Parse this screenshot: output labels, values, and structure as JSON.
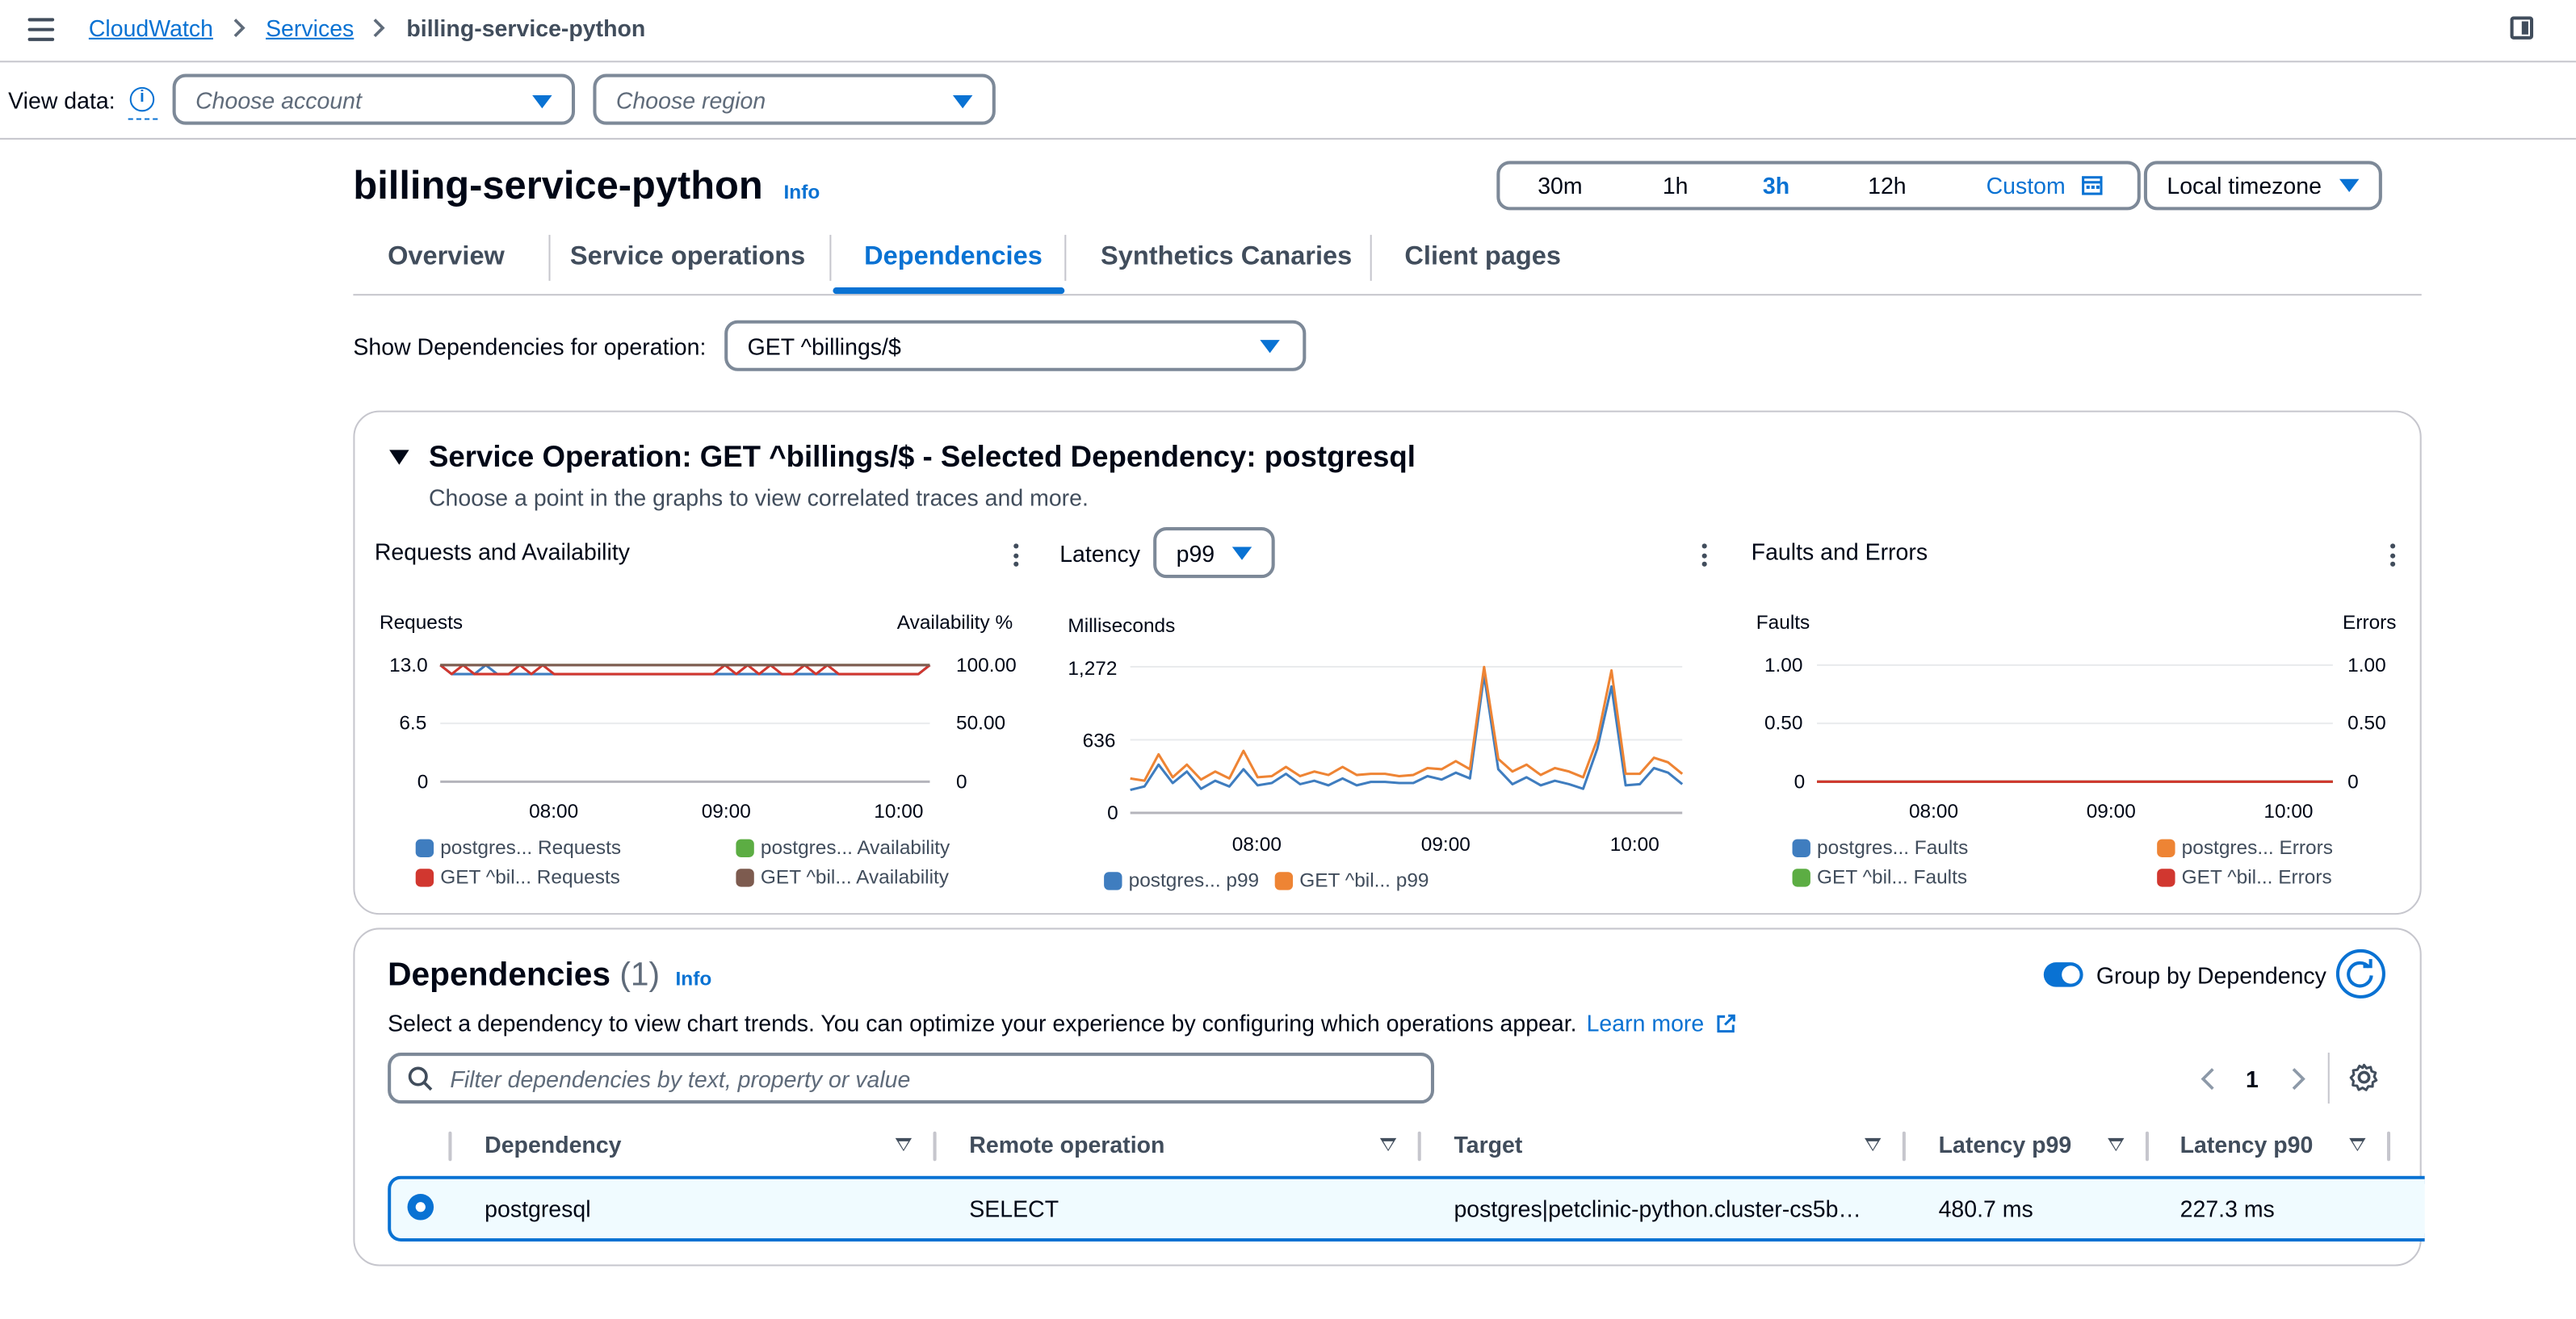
{
  "breadcrumbs": {
    "root": "CloudWatch",
    "services": "Services",
    "current": "billing-service-python"
  },
  "view_data": {
    "label": "View data:",
    "account_placeholder": "Choose account",
    "region_placeholder": "Choose region"
  },
  "header": {
    "title": "billing-service-python",
    "info": "Info"
  },
  "time_range": {
    "options": [
      "30m",
      "1h",
      "3h",
      "12h",
      "Custom"
    ],
    "selected": "3h",
    "timezone": "Local timezone"
  },
  "tabs": [
    "Overview",
    "Service operations",
    "Dependencies",
    "Synthetics Canaries",
    "Client pages"
  ],
  "active_tab": "Dependencies",
  "operation_filter": {
    "label": "Show Dependencies for operation:",
    "value": "GET ^billings/$"
  },
  "service_operation": {
    "title": "Service Operation: GET ^billings/$ - Selected Dependency: postgresql",
    "description": "Choose a point in the graphs to view correlated traces and more.",
    "requests_chart_title": "Requests and Availability",
    "latency_chart_title": "Latency",
    "latency_stat": "p99",
    "faults_chart_title": "Faults and Errors"
  },
  "colors": {
    "blue": "#3f7dbf",
    "orange": "#ee8434",
    "green": "#5cad43",
    "red": "#d1372f",
    "brown": "#7d5b4f",
    "accent": "#0972d3"
  },
  "chart_data": [
    {
      "type": "line",
      "title": "Requests and Availability",
      "ylabel": "Requests",
      "y2label": "Availability %",
      "y_ticks": [
        "13.0",
        "6.5",
        "0"
      ],
      "y2_ticks": [
        "100.00",
        "50.00",
        "0"
      ],
      "ylim": [
        0,
        13
      ],
      "y2lim": [
        0,
        100
      ],
      "x_ticks": [
        "08:00",
        "09:00",
        "10:00"
      ],
      "series": [
        {
          "name": "postgres... Requests",
          "color": "#3f7dbf",
          "axis": "left",
          "values": [
            13,
            12,
            12,
            12,
            13,
            12,
            12,
            12,
            12,
            12,
            12,
            12,
            12,
            12,
            12,
            12,
            12,
            12,
            12,
            12,
            12,
            12,
            12,
            12,
            12,
            12,
            12,
            12,
            12,
            12,
            12,
            12,
            12,
            12,
            12,
            12,
            12,
            12,
            12,
            12,
            12,
            12,
            12,
            13
          ]
        },
        {
          "name": "postgres... Availability",
          "color": "#5cad43",
          "axis": "right",
          "values": [
            100,
            100,
            100,
            100,
            100,
            100,
            100,
            100,
            100,
            100,
            100,
            100,
            100,
            100,
            100,
            100,
            100,
            100,
            100,
            100,
            100,
            100,
            100,
            100,
            100,
            100,
            100,
            100,
            100,
            100,
            100,
            100,
            100,
            100,
            100,
            100,
            100,
            100,
            100,
            100,
            100,
            100,
            100,
            100
          ]
        },
        {
          "name": "GET ^bil... Requests",
          "color": "#d1372f",
          "axis": "left",
          "values": [
            13,
            12,
            13,
            12,
            12,
            12,
            12,
            13,
            12,
            13,
            12,
            12,
            12,
            12,
            12,
            12,
            12,
            12,
            12,
            12,
            12,
            12,
            12,
            12,
            12,
            13,
            12,
            13,
            12,
            13,
            12,
            12,
            13,
            12,
            13,
            12,
            12,
            12,
            12,
            12,
            12,
            12,
            12,
            13
          ]
        },
        {
          "name": "GET ^bil... Availability",
          "color": "#7d5b4f",
          "axis": "right",
          "values": [
            100,
            100,
            100,
            100,
            100,
            100,
            100,
            100,
            100,
            100,
            100,
            100,
            100,
            100,
            100,
            100,
            100,
            100,
            100,
            100,
            100,
            100,
            100,
            100,
            100,
            100,
            100,
            100,
            100,
            100,
            100,
            100,
            100,
            100,
            100,
            100,
            100,
            100,
            100,
            100,
            100,
            100,
            100,
            100
          ]
        }
      ]
    },
    {
      "type": "line",
      "title": "Latency",
      "ylabel": "Milliseconds",
      "y_ticks": [
        "1,272",
        "636",
        "0"
      ],
      "ylim": [
        0,
        1272
      ],
      "x_ticks": [
        "08:00",
        "09:00",
        "10:00"
      ],
      "series": [
        {
          "name": "postgres... p99",
          "color": "#3f7dbf",
          "values": [
            200,
            230,
            420,
            260,
            360,
            210,
            280,
            230,
            380,
            240,
            260,
            340,
            250,
            280,
            240,
            300,
            240,
            270,
            270,
            260,
            260,
            320,
            290,
            350,
            300,
            1200,
            380,
            250,
            310,
            240,
            280,
            250,
            210,
            560,
            1100,
            240,
            250,
            390,
            350,
            250
          ]
        },
        {
          "name": "GET ^bil... p99",
          "color": "#ee8434",
          "values": [
            300,
            280,
            510,
            310,
            420,
            290,
            360,
            300,
            540,
            310,
            320,
            400,
            320,
            360,
            330,
            400,
            330,
            340,
            340,
            320,
            330,
            390,
            380,
            450,
            380,
            1270,
            470,
            360,
            420,
            330,
            390,
            360,
            310,
            640,
            1240,
            340,
            340,
            480,
            440,
            340
          ]
        }
      ]
    },
    {
      "type": "line",
      "title": "Faults and Errors",
      "ylabel": "Faults",
      "y2label": "Errors",
      "y_ticks": [
        "1.00",
        "0.50",
        "0"
      ],
      "y2_ticks": [
        "1.00",
        "0.50",
        "0"
      ],
      "ylim": [
        0,
        1
      ],
      "y2lim": [
        0,
        1
      ],
      "x_ticks": [
        "08:00",
        "09:00",
        "10:00"
      ],
      "series": [
        {
          "name": "postgres... Faults",
          "color": "#3f7dbf",
          "values": [
            0,
            0,
            0,
            0,
            0,
            0,
            0,
            0,
            0,
            0,
            0,
            0,
            0,
            0,
            0,
            0,
            0,
            0,
            0,
            0,
            0,
            0,
            0,
            0,
            0,
            0,
            0,
            0,
            0,
            0
          ]
        },
        {
          "name": "postgres... Errors",
          "color": "#ee8434",
          "values": [
            0,
            0,
            0,
            0,
            0,
            0,
            0,
            0,
            0,
            0,
            0,
            0,
            0,
            0,
            0,
            0,
            0,
            0,
            0,
            0,
            0,
            0,
            0,
            0,
            0,
            0,
            0,
            0,
            0,
            0
          ]
        },
        {
          "name": "GET ^bil... Faults",
          "color": "#5cad43",
          "values": [
            0,
            0,
            0,
            0,
            0,
            0,
            0,
            0,
            0,
            0,
            0,
            0,
            0,
            0,
            0,
            0,
            0,
            0,
            0,
            0,
            0,
            0,
            0,
            0,
            0,
            0,
            0,
            0,
            0,
            0
          ]
        },
        {
          "name": "GET ^bil... Errors",
          "color": "#d1372f",
          "values": [
            0,
            0,
            0,
            0,
            0,
            0,
            0,
            0,
            0,
            0,
            0,
            0,
            0,
            0,
            0,
            0,
            0,
            0,
            0,
            0,
            0,
            0,
            0,
            0,
            0,
            0,
            0,
            0,
            0,
            0
          ]
        }
      ]
    }
  ],
  "dependencies": {
    "title": "Dependencies",
    "count": "(1)",
    "info": "Info",
    "group_by_label": "Group by Dependency",
    "description": "Select a dependency to view chart trends. You can optimize your experience by configuring which operations appear.",
    "learn_more": "Learn more",
    "filter_placeholder": "Filter dependencies by text, property or value",
    "page": "1",
    "columns": [
      "Dependency",
      "Remote operation",
      "Target",
      "Latency p99",
      "Latency p90"
    ],
    "rows": [
      {
        "dependency": "postgresql",
        "remote_operation": "SELECT",
        "target": "postgres|petclinic-python.cluster-cs5b…",
        "latency_p99": "480.7 ms",
        "latency_p90": "227.3 ms"
      }
    ]
  }
}
